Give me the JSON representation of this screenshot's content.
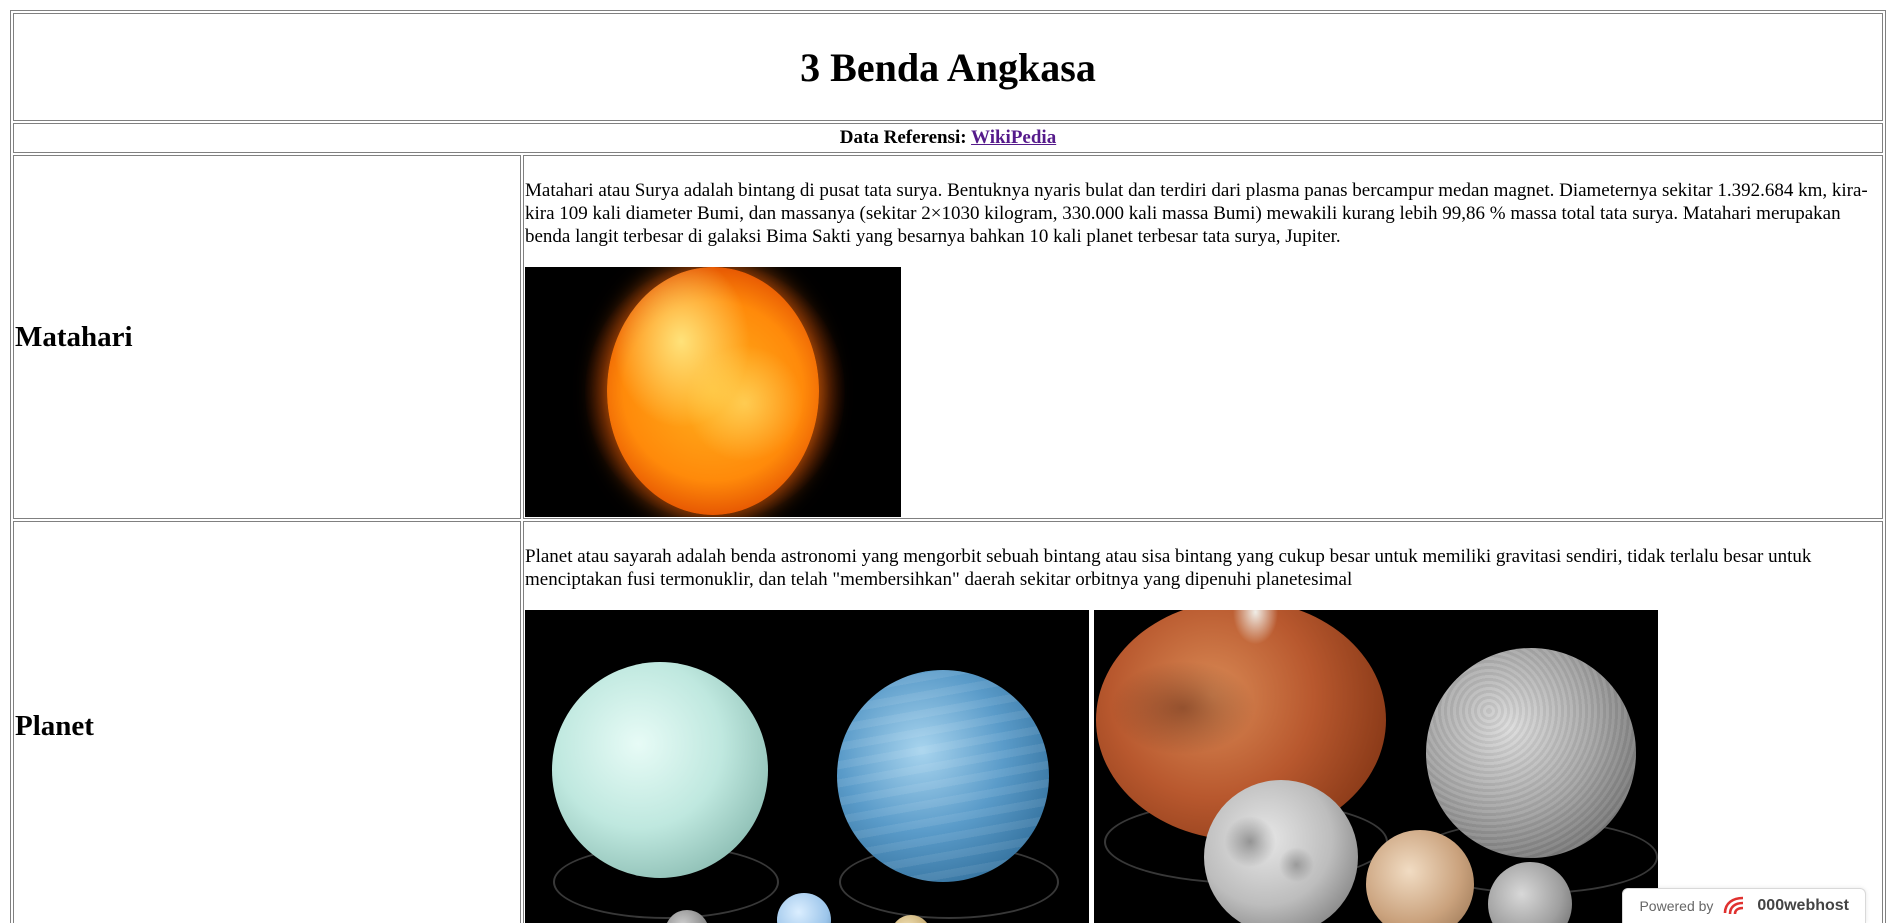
{
  "page": {
    "title": "3 Benda Angkasa",
    "reference_label": "Data Referensi:",
    "reference_link": "WikiPedia"
  },
  "rows": [
    {
      "label": "Matahari",
      "description": "Matahari atau Surya adalah bintang di pusat tata surya. Bentuknya nyaris bulat dan terdiri dari plasma panas bercampur medan magnet. Diameternya sekitar 1.392.684 km, kira-kira 109 kali diameter Bumi, dan massanya (sekitar 2×1030 kilogram, 330.000 kali massa Bumi) mewakili kurang lebih 99,86 % massa total tata surya. Matahari merupakan benda langit terbesar di galaksi Bima Sakti yang besarnya bahkan 10 kali planet terbesar tata surya, Jupiter."
    },
    {
      "label": "Planet",
      "description": "Planet atau sayarah adalah benda astronomi yang mengorbit sebuah bintang atau sisa bintang yang cukup besar untuk memiliki gravitasi sendiri, tidak terlalu besar untuk menciptakan fusi termonuklir, dan telah \"membersihkan\" daerah sekitar orbitnya yang dipenuhi planetesimal"
    }
  ],
  "badge": {
    "powered_by": "Powered by",
    "brand": "000webhost"
  },
  "colors": {
    "link": "#551a8b",
    "border": "#808080"
  }
}
